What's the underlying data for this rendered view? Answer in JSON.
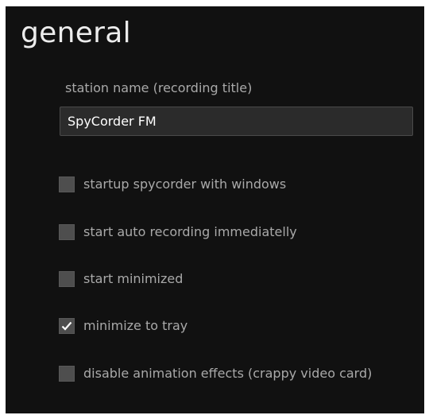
{
  "section": {
    "title": "general"
  },
  "station": {
    "label": "station name (recording title)",
    "value": "SpyCorder FM"
  },
  "options": [
    {
      "label": "startup spycorder with windows",
      "checked": false
    },
    {
      "label": "start auto recording immediatelly",
      "checked": false
    },
    {
      "label": "start minimized",
      "checked": false
    },
    {
      "label": "minimize to tray",
      "checked": true
    },
    {
      "label": "disable animation effects (crappy video card)",
      "checked": false
    }
  ],
  "colors": {
    "panel_background": "#111111",
    "title_text": "#ececec",
    "label_text": "#a9a9a9",
    "input_background": "#2b2b2b",
    "checkbox_fill": "#4e4e4e",
    "checkmark": "#ffffff"
  },
  "icons": {
    "checkmark": "checkmark-icon"
  }
}
